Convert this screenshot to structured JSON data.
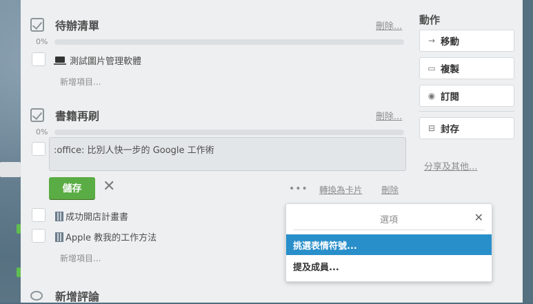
{
  "checklists": [
    {
      "title": "待辦清單",
      "delete_label": "刪除...",
      "progress_label": "0%",
      "progress": 0,
      "items": [
        {
          "text": "測試圖片管理軟體",
          "icon": "laptop-icon"
        }
      ],
      "add_item_label": "新增項目..."
    },
    {
      "title": "書籍再刷",
      "delete_label": "刪除...",
      "progress_label": "0%",
      "progress": 0,
      "editing_text": ":office: 比別人快一步的 Google 工作術",
      "items": [
        {
          "text": "成功開店計畫書",
          "icon": "office-building-icon"
        },
        {
          "text": "Apple 教我的工作方法",
          "icon": "office-building-icon"
        }
      ],
      "add_item_label": "新增項目..."
    }
  ],
  "editor": {
    "save_label": "儲存",
    "convert_label": "轉換為卡片",
    "delete_label": "刪除"
  },
  "comment": {
    "title": "新增評論"
  },
  "sidebar": {
    "title": "動作",
    "buttons": [
      {
        "label": "移動",
        "icon": "arrow-right-icon"
      },
      {
        "label": "複製",
        "icon": "copy-icon"
      },
      {
        "label": "訂閱",
        "icon": "eye-icon"
      },
      {
        "label": "封存",
        "icon": "archive-icon"
      }
    ],
    "share_label": "分享及其他..."
  },
  "popover": {
    "title": "選項",
    "items": [
      {
        "label": "挑選表情符號...",
        "active": true
      },
      {
        "label": "提及成員...",
        "active": false
      }
    ]
  },
  "colors": {
    "save_green": "#5aac44",
    "highlight_blue": "#298fca",
    "modal_bg": "#edeff0"
  }
}
